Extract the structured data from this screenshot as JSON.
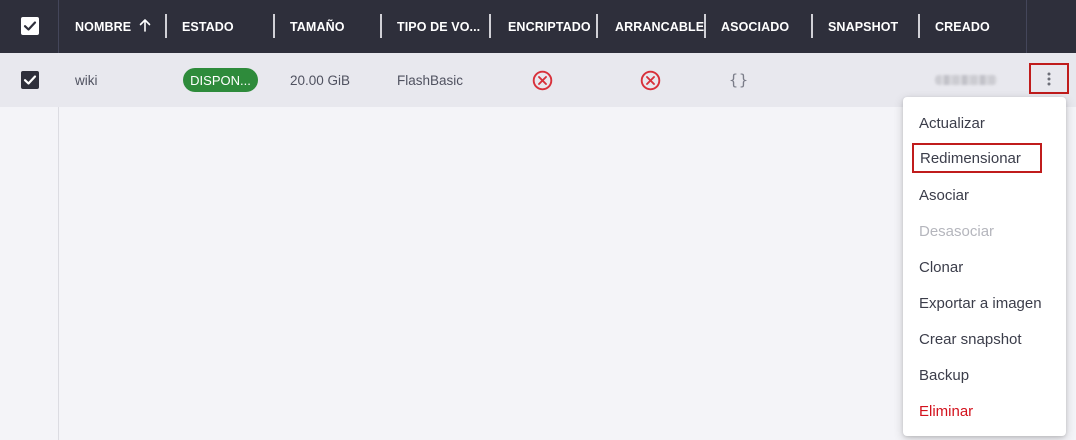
{
  "table": {
    "columns": [
      {
        "label": "NOMBRE",
        "sort_icon": "arrow-up-icon"
      },
      {
        "label": "ESTADO"
      },
      {
        "label": "TAMAÑO"
      },
      {
        "label": "TIPO DE VO..."
      },
      {
        "label": "ENCRIPTADO"
      },
      {
        "label": "ARRANCABLE"
      },
      {
        "label": "ASOCIADO"
      },
      {
        "label": "SNAPSHOT"
      },
      {
        "label": "CREADO"
      }
    ],
    "rows": [
      {
        "selected": true,
        "nombre": "wiki",
        "estado": "DISPON...",
        "tamano": "20.00 GiB",
        "tipo": "FlashBasic",
        "encriptado_icon": "x-circle-icon",
        "arrancable_icon": "x-circle-icon",
        "asociado": "{}",
        "snapshot": "",
        "creado": "blurred-date"
      }
    ]
  },
  "menu": {
    "items": [
      {
        "label": "Actualizar",
        "state": "normal"
      },
      {
        "label": "Redimensionar",
        "state": "highlighted"
      },
      {
        "label": "Asociar",
        "state": "normal"
      },
      {
        "label": "Desasociar",
        "state": "disabled"
      },
      {
        "label": "Clonar",
        "state": "normal"
      },
      {
        "label": "Exportar a imagen",
        "state": "normal"
      },
      {
        "label": "Crear snapshot",
        "state": "normal"
      },
      {
        "label": "Backup",
        "state": "normal"
      },
      {
        "label": "Eliminar",
        "state": "danger"
      }
    ]
  },
  "colors": {
    "header_bg": "#2e2f3b",
    "status_green": "#2e8b3b",
    "danger_red": "#d3121d",
    "highlight_border": "#c01c1c",
    "icon_red": "#d8303a"
  }
}
